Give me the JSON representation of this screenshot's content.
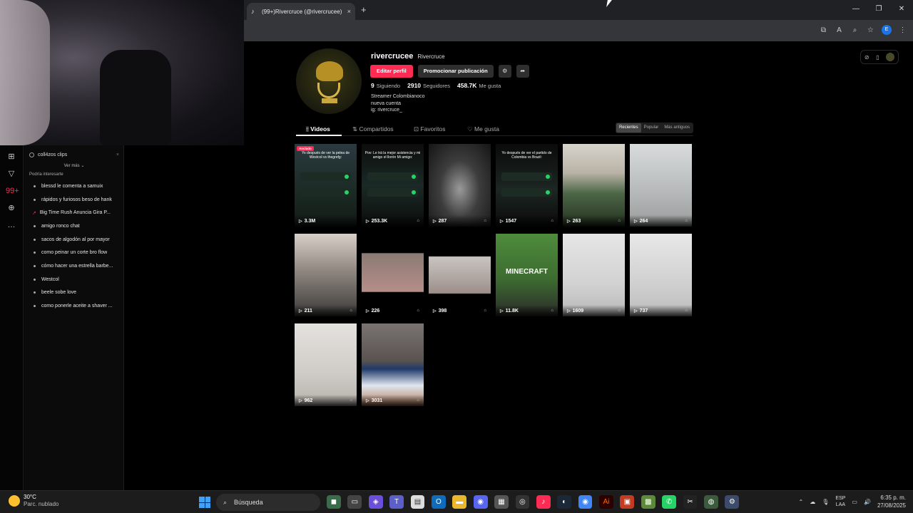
{
  "browser": {
    "tab_title": "(99+)Rivercruce (@rivercrucee)",
    "tab_close": "×",
    "new_tab": "+",
    "window_controls": [
      "—",
      "❐",
      "✕"
    ],
    "toolbar_icons": [
      "⧉",
      "A",
      "⌕",
      "☆"
    ],
    "profile_initial": "E",
    "menu": "⋮"
  },
  "sidebar": {
    "panel_title": "coll4zos clips",
    "more_label": "Ver más ⌄",
    "section_title": "Podría interesarte",
    "suggestions": [
      {
        "label": "blessd le comenta a samuix",
        "trend": false
      },
      {
        "label": "rápidos y furiosos beso de hank",
        "trend": false
      },
      {
        "label": "Big Time Rush Anuncia Gira P...",
        "trend": true
      },
      {
        "label": "amigo ronco chat",
        "trend": false
      },
      {
        "label": "sacos de algodón al por mayor",
        "trend": false
      },
      {
        "label": "como peinar un corte bro flow",
        "trend": false
      },
      {
        "label": "cómo hacer una estrella barbe...",
        "trend": false
      },
      {
        "label": "Westcol",
        "trend": false
      },
      {
        "label": "beele sobe love",
        "trend": false
      },
      {
        "label": "como ponerle aceite a shaver ...",
        "trend": false
      }
    ],
    "strip_icons": [
      "⊞",
      "▽",
      "99+",
      "⊕",
      "…"
    ]
  },
  "profile": {
    "username": "rivercrucee",
    "nickname": "Rivercruce",
    "edit_label": "Editar perfil",
    "promote_label": "Promocionar publicación",
    "following_count": "9",
    "following_label": "Siguiendo",
    "followers_count": "2910",
    "followers_label": "Seguidores",
    "likes_count": "458.7K",
    "likes_label": "Me gusta",
    "bio_lines": [
      "Streamer Colombianoco",
      "nueva cuenta",
      "ig: rivercruce_"
    ],
    "avatar_badge": "RIVERCRUCE"
  },
  "tabs": {
    "videos": "Videos",
    "shared": "Compartidos",
    "favorites": "Favoritos",
    "liked": "Me gusta"
  },
  "sort": {
    "recent": "Recientes",
    "popular": "Popular",
    "oldest": "Más antiguos"
  },
  "videos": [
    {
      "views": "3.3M",
      "caption": "Yo después de ver la pelea de Westcol vs thegrefg:",
      "pinned": "Anclado"
    },
    {
      "views": "253.3K",
      "caption": "Pov: Le trá la mejor asistencia y mi amigo el llorón Mi amigo:"
    },
    {
      "views": "287",
      "caption": ""
    },
    {
      "views": "1547",
      "caption": "Yo después de ver el partido de Colombia vs Brazil:"
    },
    {
      "views": "263",
      "caption": ""
    },
    {
      "views": "264",
      "caption": ""
    },
    {
      "views": "211",
      "caption": ""
    },
    {
      "views": "226",
      "caption": ""
    },
    {
      "views": "398",
      "caption": ""
    },
    {
      "views": "11.8K",
      "caption": "MINECRAFT"
    },
    {
      "views": "1609",
      "caption": ""
    },
    {
      "views": "737",
      "caption": ""
    },
    {
      "views": "962",
      "caption": ""
    },
    {
      "views": "3031",
      "caption": ""
    }
  ],
  "taskbar": {
    "temperature": "30°C",
    "weather": "Parc. nublado",
    "search_placeholder": "Búsqueda",
    "lang_top": "ESP",
    "lang_bottom": "LAA",
    "time": "6:35 p. m.",
    "date": "27/08/2025"
  }
}
